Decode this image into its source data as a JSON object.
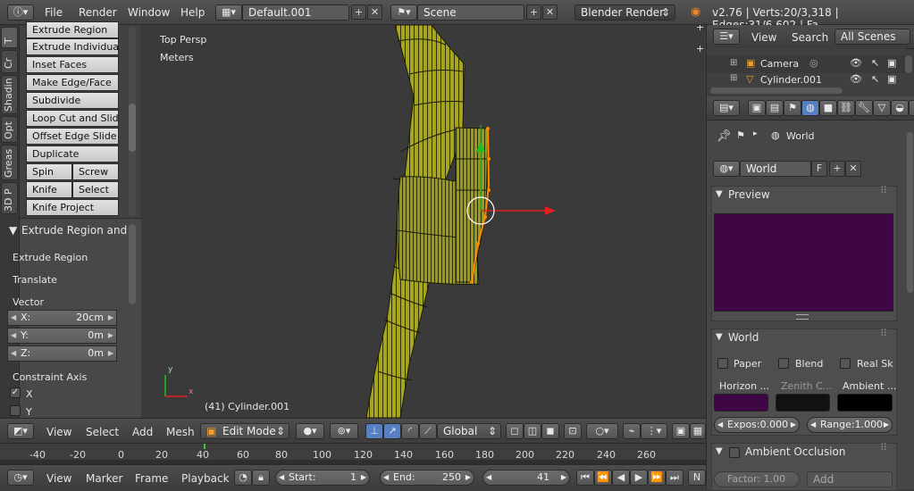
{
  "topbar": {
    "menus": [
      "File",
      "Render",
      "Window",
      "Help"
    ],
    "screen_layout": "Default.001",
    "scene": "Scene",
    "render_engine": "Blender Render",
    "stats": "v2.76 | Verts:20/3,318 | Edges:31/6,602 | Fa"
  },
  "shelf": {
    "tabs": [
      "T",
      "Cr",
      "Shadin",
      "Opt",
      "Greas",
      "3D P"
    ],
    "buttons": {
      "extrude_region": "Extrude Region",
      "extrude_individual": "Extrude Individual",
      "inset_faces": "Inset Faces",
      "make_edge_face": "Make Edge/Face",
      "subdivide": "Subdivide",
      "loop_cut": "Loop Cut and Slide",
      "offset_edge": "Offset Edge Slide",
      "duplicate": "Duplicate",
      "spin": "Spin",
      "screw": "Screw",
      "knife": "Knife",
      "select": "Select",
      "knife_project": "Knife Project"
    },
    "operator": {
      "title": "Extrude Region and",
      "name": "Extrude Region",
      "translate": "Translate",
      "vector_label": "Vector",
      "x_label": "X:",
      "x_value": "20cm",
      "y_label": "Y:",
      "y_value": "0m",
      "z_label": "Z:",
      "z_value": "0m",
      "constraint_label": "Constraint Axis",
      "cx": "X",
      "cy": "Y"
    }
  },
  "viewport": {
    "view_name": "Top Persp",
    "units": "Meters",
    "object_info": "(41) Cylinder.001",
    "axis_y": "y",
    "axis_x": "x"
  },
  "header3d": {
    "menus": [
      "View",
      "Select",
      "Add",
      "Mesh"
    ],
    "mode": "Edit Mode",
    "orientation": "Global"
  },
  "timeline": {
    "ticks": [
      "-40",
      "-20",
      "0",
      "20",
      "40",
      "60",
      "80",
      "100",
      "120",
      "140",
      "160",
      "180",
      "200",
      "220",
      "240",
      "260"
    ],
    "menus": [
      "View",
      "Marker",
      "Frame",
      "Playback"
    ],
    "start_label": "Start:",
    "start_value": "1",
    "end_label": "End:",
    "end_value": "250",
    "current_frame": "41",
    "trailing": "N"
  },
  "outliner": {
    "menus": [
      "View",
      "Search"
    ],
    "filter": "All Scenes",
    "items": [
      "Camera",
      "Cylinder.001"
    ]
  },
  "properties": {
    "context": "World",
    "world_name": "World",
    "fake_user": "F",
    "preview_title": "Preview",
    "world_panel_title": "World",
    "paper": "Paper",
    "blend": "Blend",
    "real_sky": "Real Sk",
    "horizon": "Horizon ...",
    "zenith": "Zenith C...",
    "ambient": "Ambient ...",
    "exposure": "Expos:0.000",
    "range": "Range:1.000",
    "ao_title": "Ambient Occlusion",
    "factor": "Factor: 1.00",
    "add": "Add"
  },
  "colors": {
    "preview": "#3e0645",
    "horizon": "#3e0645",
    "zenith": "#111111",
    "ambient": "#000000",
    "mesh": "#9c9c1e",
    "selected": "#ff8c00"
  }
}
